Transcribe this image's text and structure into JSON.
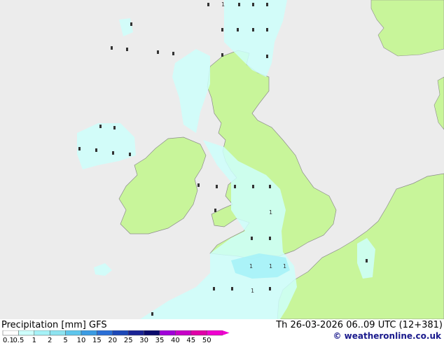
{
  "title": {
    "label": "Precipitation [mm]",
    "model": "GFS"
  },
  "valid_time": "Th 26-03-2026 06..09 UTC (12+381)",
  "credit": "© weatheronline.co.uk",
  "legend": {
    "values": [
      "0.1",
      "0.5",
      "1",
      "2",
      "5",
      "10",
      "15",
      "20",
      "25",
      "30",
      "35",
      "40",
      "45",
      "50"
    ],
    "colors": [
      "#ffffff",
      "#cefffc",
      "#a6f2f7",
      "#8ee3f0",
      "#5ec6ec",
      "#3a9be2",
      "#2a6fd6",
      "#1c48b8",
      "#1a2395",
      "#0a0a6c",
      "#a000d8",
      "#c800c8",
      "#e000a8",
      "#f000d0"
    ]
  },
  "map_colors": {
    "sea": "#ececec",
    "land": "#c8f59a",
    "precip_light": "#cefffc",
    "precip_moderate": "#a6f2f7",
    "coast": "#8c8c8c"
  },
  "station_markers": [
    {
      "text": "1"
    },
    {
      "text": "1"
    },
    {
      "text": "1"
    },
    {
      "text": "1"
    },
    {
      "text": "1"
    },
    {
      "text": "1"
    }
  ]
}
